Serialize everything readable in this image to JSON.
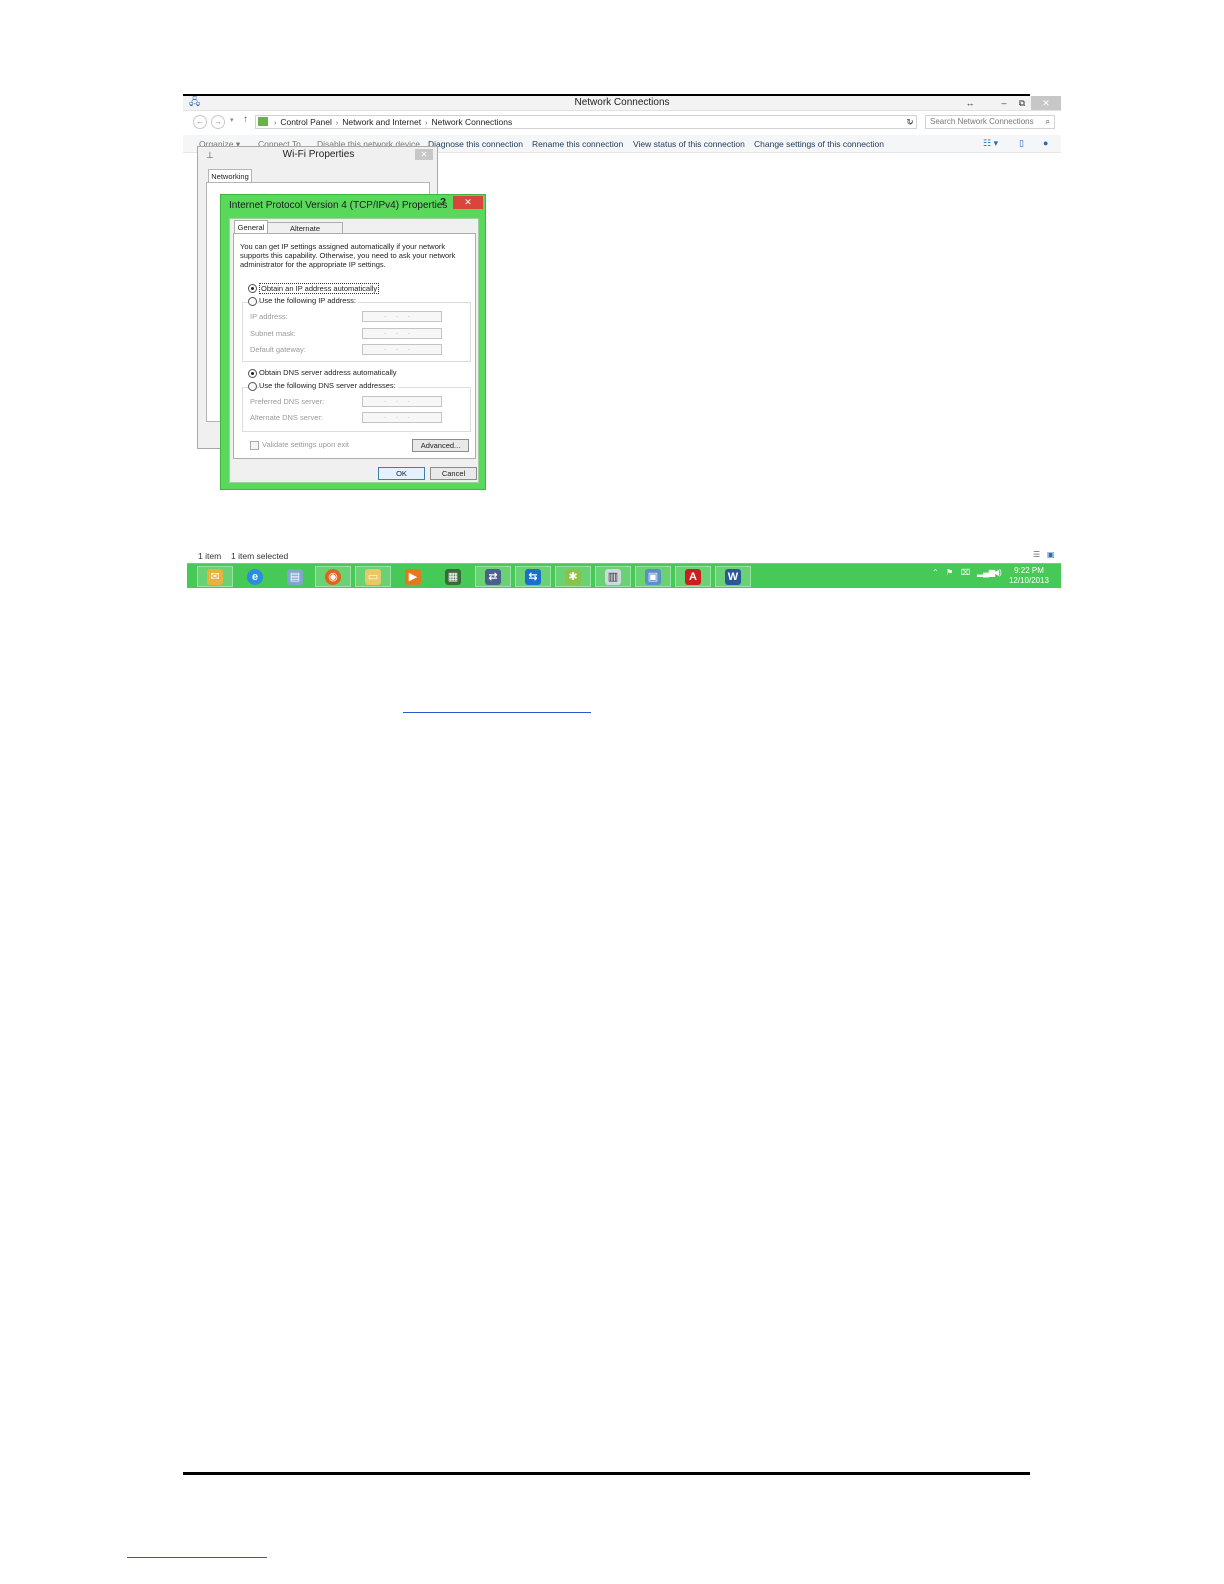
{
  "explorer": {
    "title": "Network Connections",
    "window_buttons": {
      "resize": "↔",
      "minimize": "–",
      "restore": "⧉",
      "close": "✕"
    },
    "breadcrumb": [
      "Control Panel",
      "Network and Internet",
      "Network Connections"
    ],
    "search_placeholder": "Search Network Connections",
    "toolbar": {
      "organize": "Organize ▾",
      "connect_to": "Connect To",
      "disable": "Disable this network device",
      "diagnose": "Diagnose this connection",
      "rename": "Rename this connection",
      "view_status": "View status of this connection",
      "change_settings": "Change settings of this connection"
    },
    "status": {
      "count": "1 item",
      "selected": "1 item selected"
    }
  },
  "wifi_dialog": {
    "title": "Wi-Fi Properties",
    "tab": "Networking",
    "close": "✕"
  },
  "ipv4_dialog": {
    "title": "Internet Protocol Version 4 (TCP/IPv4) Properties",
    "help": "?",
    "close": "✕",
    "tabs": {
      "general": "General",
      "alternate": "Alternate Configuration"
    },
    "description": "You can get IP settings assigned automatically if your network supports this capability. Otherwise, you need to ask your network administrator for the appropriate IP settings.",
    "ip_auto": "Obtain an IP address automatically",
    "ip_manual": "Use the following IP address:",
    "ip_address_label": "IP address:",
    "subnet_label": "Subnet mask:",
    "gateway_label": "Default gateway:",
    "dns_auto": "Obtain DNS server address automatically",
    "dns_manual": "Use the following DNS server addresses:",
    "preferred_dns_label": "Preferred DNS server:",
    "alternate_dns_label": "Alternate DNS server:",
    "ip_placeholder": "...",
    "validate": "Validate settings upon exit",
    "advanced": "Advanced...",
    "ok": "OK",
    "cancel": "Cancel",
    "selected": {
      "ip_mode": "automatic",
      "dns_mode": "automatic"
    }
  },
  "taskbar": {
    "accent": "#47c957",
    "apps": [
      "outlook-icon",
      "internet-explorer-icon",
      "notepad-icon",
      "firefox-icon",
      "file-explorer-icon",
      "media-player-icon",
      "network-tool-icon",
      "remote-desktop-icon",
      "teamviewer-icon",
      "settings-icon",
      "calculator-icon",
      "remote-connection-icon",
      "adobe-reader-icon",
      "word-icon"
    ],
    "clock_time": "9:22 PM",
    "clock_date": "12/10/2013"
  }
}
